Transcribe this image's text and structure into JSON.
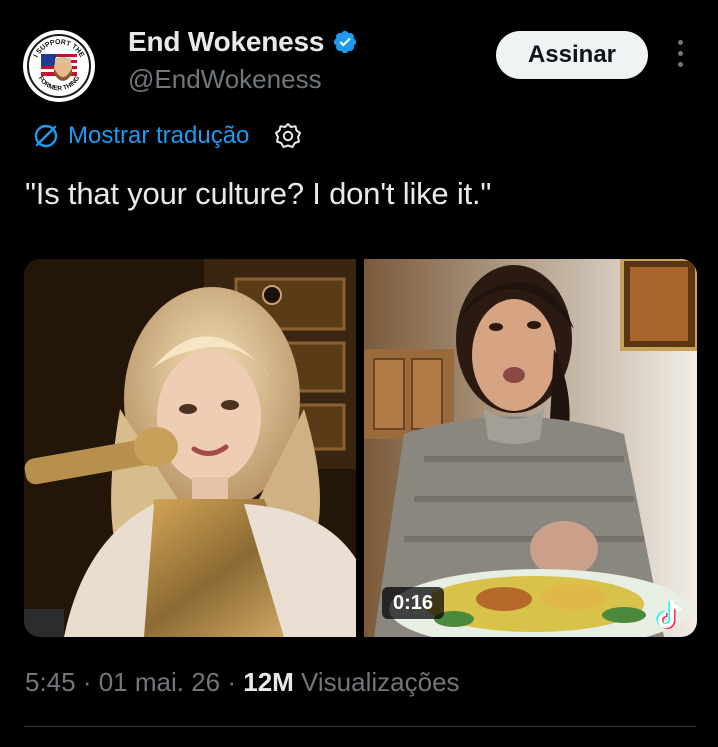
{
  "header": {
    "display_name": "End Wokeness",
    "handle": "@EndWokeness",
    "subscribe_label": "Assinar",
    "avatar_text_top": "I SUPPORT THE",
    "avatar_text_bottom": "FORMER THING",
    "verified_icon": "verified-badge-icon",
    "more_icon": "more-vertical-icon"
  },
  "translate": {
    "label": "Mostrar tradução",
    "icon": "translate-icon",
    "settings_icon": "gear-icon"
  },
  "tweet": {
    "text": "\"Is that your culture? I don't like it.\""
  },
  "media": {
    "duration": "0:16",
    "watermark_icon": "tiktok-icon"
  },
  "meta": {
    "time": "5:45",
    "sep1": " · ",
    "date": "01 mai. 26",
    "sep2": " · ",
    "views_count": "12M",
    "views_label": " Visualizações"
  },
  "colors": {
    "background": "#000000",
    "text": "#e7e9ea",
    "secondary": "#71767b",
    "accent": "#1d9bf0",
    "button_bg": "#eff3f4"
  }
}
